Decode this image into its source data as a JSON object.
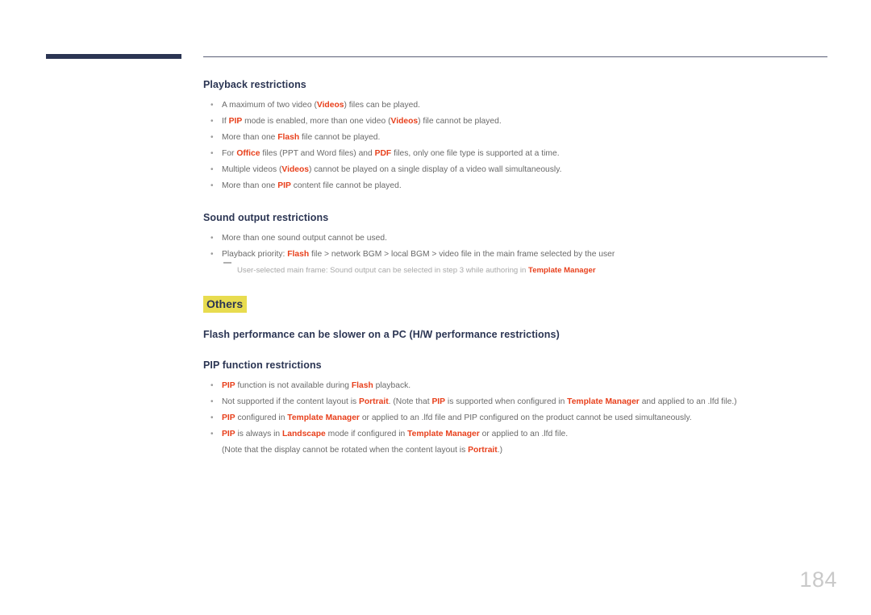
{
  "page": {
    "number": "184"
  },
  "sections": [
    {
      "id": "playback-restrictions",
      "heading": "Playback restrictions",
      "bullets": [
        [
          {
            "t": "A maximum of two video ("
          },
          {
            "t": "Videos",
            "hl": true
          },
          {
            "t": ") files can be played."
          }
        ],
        [
          {
            "t": "If "
          },
          {
            "t": "PIP",
            "hl": true
          },
          {
            "t": " mode is enabled, more than one video ("
          },
          {
            "t": "Videos",
            "hl": true
          },
          {
            "t": ") file cannot be played."
          }
        ],
        [
          {
            "t": "More than one "
          },
          {
            "t": "Flash",
            "hl": true
          },
          {
            "t": " file cannot be played."
          }
        ],
        [
          {
            "t": "For "
          },
          {
            "t": "Office",
            "hl": true
          },
          {
            "t": " files (PPT and Word files) and "
          },
          {
            "t": "PDF",
            "hl": true
          },
          {
            "t": " files, only one file type is supported at a time."
          }
        ],
        [
          {
            "t": "Multiple videos ("
          },
          {
            "t": "Videos",
            "hl": true
          },
          {
            "t": ") cannot be played on a single display of a video wall simultaneously."
          }
        ],
        [
          {
            "t": "More than one "
          },
          {
            "t": "PIP",
            "hl": true
          },
          {
            "t": " content file cannot be played."
          }
        ]
      ]
    },
    {
      "id": "sound-output-restrictions",
      "heading": "Sound output restrictions",
      "bullets": [
        [
          {
            "t": "More than one sound output cannot be used."
          }
        ],
        [
          {
            "t": "Playback priority: "
          },
          {
            "t": "Flash",
            "hl": true
          },
          {
            "t": " file > network BGM > local BGM > video file in the main frame selected by the user"
          }
        ]
      ],
      "subnote": [
        {
          "t": "User-selected main frame: Sound output can be selected in step 3 while authoring in "
        },
        {
          "t": "Template Manager",
          "hl": true
        }
      ]
    }
  ],
  "others": {
    "title": "Others",
    "heading_flash": "Flash performance can be slower on a PC (H/W performance restrictions)",
    "heading_pip": "PIP function restrictions",
    "bullets": [
      [
        {
          "t": "PIP",
          "hl": true
        },
        {
          "t": " function is not available during "
        },
        {
          "t": "Flash",
          "hl": true
        },
        {
          "t": " playback."
        }
      ],
      [
        {
          "t": "Not supported if the content layout is "
        },
        {
          "t": "Portrait",
          "hl": true
        },
        {
          "t": ".  (Note that "
        },
        {
          "t": "PIP",
          "hl": true
        },
        {
          "t": " is supported when configured in "
        },
        {
          "t": "Template Manager",
          "hl": true
        },
        {
          "t": " and applied to an .lfd file.)"
        }
      ],
      [
        {
          "t": "PIP",
          "hl": true
        },
        {
          "t": " configured in "
        },
        {
          "t": "Template Manager",
          "hl": true
        },
        {
          "t": " or applied to an .lfd file and PIP configured on the product cannot be used simultaneously."
        }
      ],
      [
        {
          "t": "PIP",
          "hl": true
        },
        {
          "t": " is always in "
        },
        {
          "t": "Landscape",
          "hl": true
        },
        {
          "t": " mode if configured in "
        },
        {
          "t": "Template Manager",
          "hl": true
        },
        {
          "t": " or applied to an .lfd file."
        }
      ]
    ],
    "continuation": [
      {
        "t": "(Note that the display cannot be rotated when the content layout is "
      },
      {
        "t": "Portrait",
        "hl": true
      },
      {
        "t": ".)"
      }
    ]
  },
  "colors": {
    "accent": "#e8401c",
    "navy": "#2b3553",
    "highlight": "#e8dc4f",
    "body_text": "#6a6a6a",
    "page_number": "#c9c9c9"
  },
  "icons": {
    "bullet": "bullet-dot-icon",
    "subnote_dash": "dash-marker-icon"
  }
}
